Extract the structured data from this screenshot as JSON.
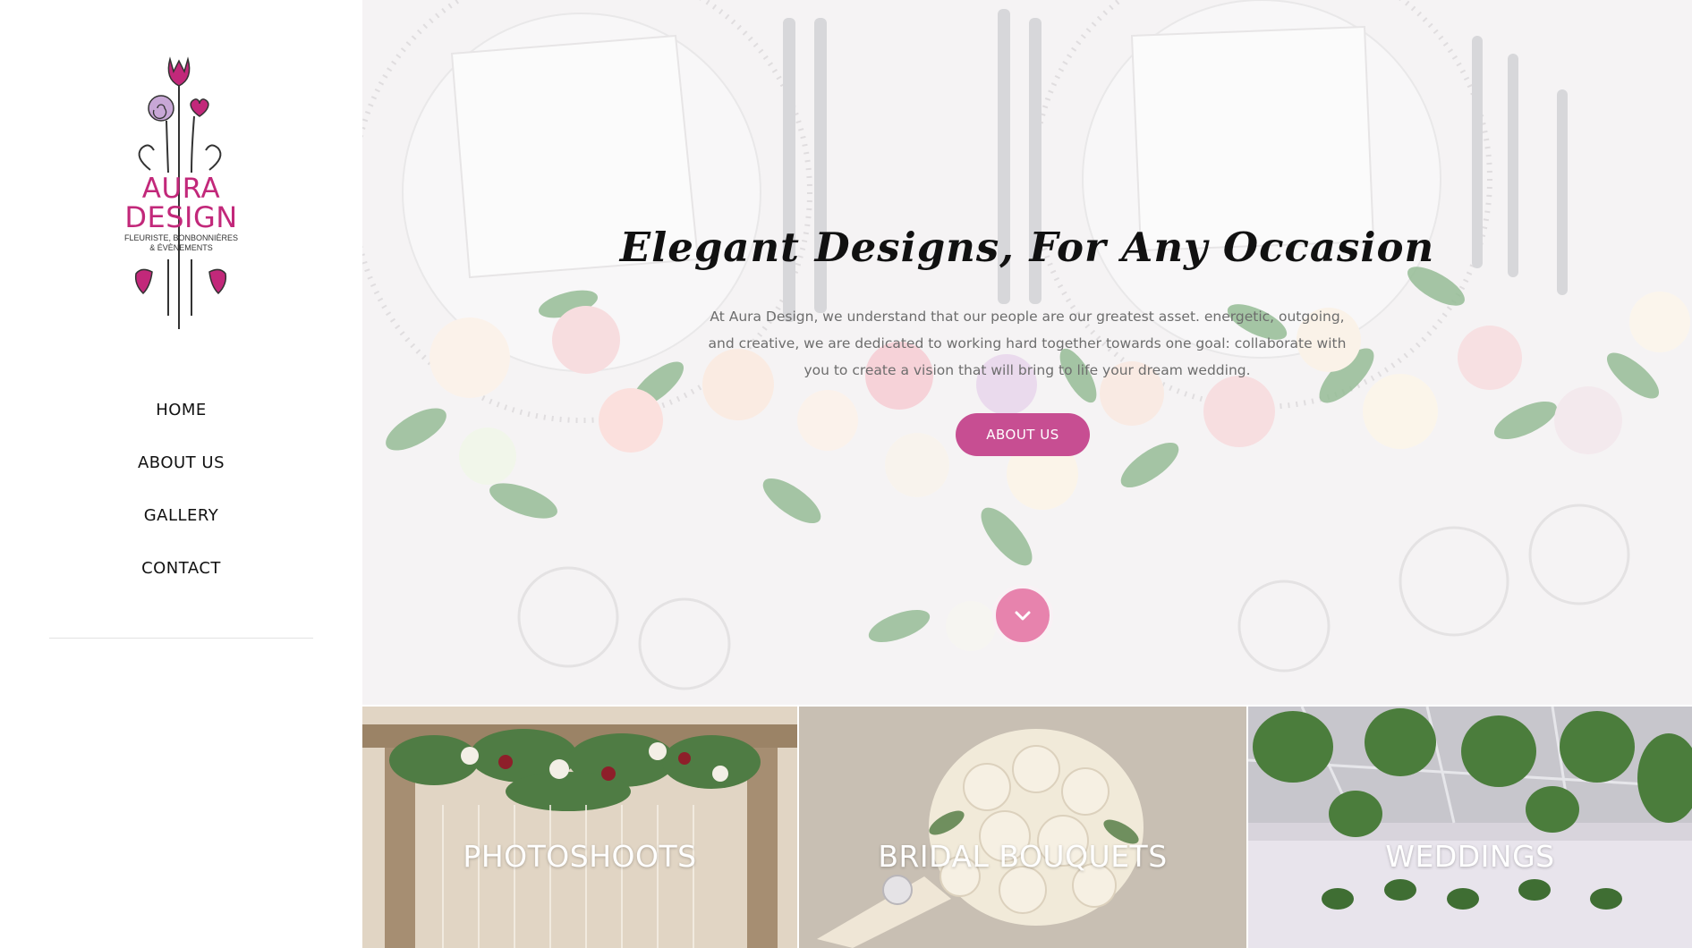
{
  "brand": {
    "line1": "AURA",
    "line2": "DESIGN",
    "tagline1": "FLEURISTE, BONBONNIÈRES",
    "tagline2": "& ÉVÈNEMENTS",
    "color": "#c2287a"
  },
  "nav": {
    "items": [
      {
        "label": "HOME"
      },
      {
        "label": "ABOUT US"
      },
      {
        "label": "GALLERY"
      },
      {
        "label": "CONTACT"
      }
    ]
  },
  "hero": {
    "title": "Elegant Designs, For Any Occasion",
    "text": "At Aura Design, we understand that our people are our greatest asset. energetic, outgoing, and creative, we are dedicated to working hard together towards one goal: collaborate with you to create a vision that will bring to life your dream wedding.",
    "button_label": "ABOUT US",
    "scroll_icon": "chevron-down-icon",
    "accent_color": "#c74e92"
  },
  "tiles": [
    {
      "label": "PHOTOSHOOTS"
    },
    {
      "label": "BRIDAL BOUQUETS"
    },
    {
      "label": "WEDDINGS"
    }
  ]
}
